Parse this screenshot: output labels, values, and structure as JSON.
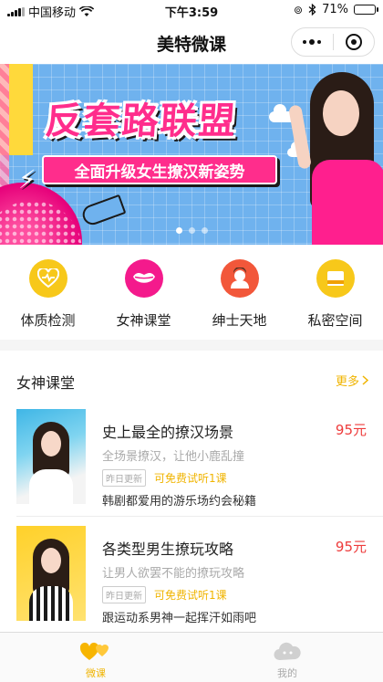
{
  "status_bar": {
    "carrier": "中国移动",
    "time": "下午3:59",
    "battery": "71%",
    "battery_level": 0.71
  },
  "nav": {
    "title": "美特微课",
    "more_icon": "more-dots-icon",
    "close_icon": "target-circle-icon"
  },
  "banner": {
    "title": "反套路联盟",
    "tagline": "全面升级女生撩汉新姿势",
    "slide_count": 3,
    "active_slide": 0
  },
  "categories": [
    {
      "label": "体质检测",
      "icon": "heart-pulse-icon",
      "color": "#f7c81a"
    },
    {
      "label": "女神课堂",
      "icon": "lips-icon",
      "color": "#f41a8c"
    },
    {
      "label": "绅士天地",
      "icon": "gentleman-icon",
      "color": "#f2573a"
    },
    {
      "label": "私密空间",
      "icon": "book-icon",
      "color": "#f7c81a"
    }
  ],
  "section": {
    "title": "女神课堂",
    "more_label": "更多"
  },
  "courses": [
    {
      "title": "史上最全的撩汉场景",
      "price": "95元",
      "desc": "全场景撩汉，让他小鹿乱撞",
      "update_tag": "昨日更新",
      "trial": "可免费试听1课",
      "subtitle": "韩剧都爱用的游乐场约会秘籍"
    },
    {
      "title": "各类型男生撩玩攻略",
      "price": "95元",
      "desc": "让男人欲罢不能的撩玩攻略",
      "update_tag": "昨日更新",
      "trial": "可免费试听1课",
      "subtitle": "跟运动系男神一起挥汗如雨吧"
    }
  ],
  "tab_bar": {
    "tabs": [
      {
        "label": "微课",
        "icon": "hearts-icon",
        "active": true
      },
      {
        "label": "我的",
        "icon": "cloud-face-icon",
        "active": false
      }
    ]
  },
  "colors": {
    "accent": "#f0b400",
    "price": "#ee3b3b",
    "pink": "#ff2d8c"
  }
}
